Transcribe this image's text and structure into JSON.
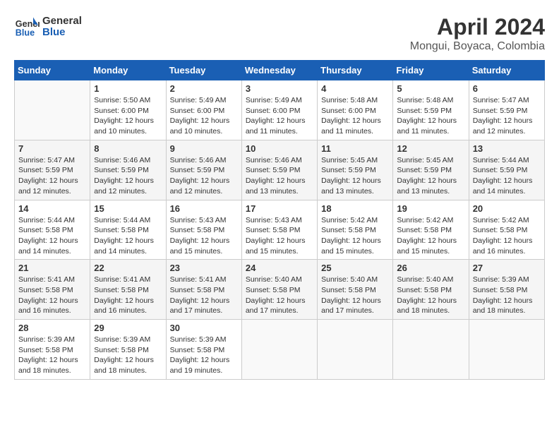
{
  "header": {
    "logo_line1": "General",
    "logo_line2": "Blue",
    "title": "April 2024",
    "subtitle": "Mongui, Boyaca, Colombia"
  },
  "calendar": {
    "days_of_week": [
      "Sunday",
      "Monday",
      "Tuesday",
      "Wednesday",
      "Thursday",
      "Friday",
      "Saturday"
    ],
    "weeks": [
      [
        {
          "day": "",
          "info": ""
        },
        {
          "day": "1",
          "info": "Sunrise: 5:50 AM\nSunset: 6:00 PM\nDaylight: 12 hours\nand 10 minutes."
        },
        {
          "day": "2",
          "info": "Sunrise: 5:49 AM\nSunset: 6:00 PM\nDaylight: 12 hours\nand 10 minutes."
        },
        {
          "day": "3",
          "info": "Sunrise: 5:49 AM\nSunset: 6:00 PM\nDaylight: 12 hours\nand 11 minutes."
        },
        {
          "day": "4",
          "info": "Sunrise: 5:48 AM\nSunset: 6:00 PM\nDaylight: 12 hours\nand 11 minutes."
        },
        {
          "day": "5",
          "info": "Sunrise: 5:48 AM\nSunset: 5:59 PM\nDaylight: 12 hours\nand 11 minutes."
        },
        {
          "day": "6",
          "info": "Sunrise: 5:47 AM\nSunset: 5:59 PM\nDaylight: 12 hours\nand 12 minutes."
        }
      ],
      [
        {
          "day": "7",
          "info": "Sunrise: 5:47 AM\nSunset: 5:59 PM\nDaylight: 12 hours\nand 12 minutes."
        },
        {
          "day": "8",
          "info": "Sunrise: 5:46 AM\nSunset: 5:59 PM\nDaylight: 12 hours\nand 12 minutes."
        },
        {
          "day": "9",
          "info": "Sunrise: 5:46 AM\nSunset: 5:59 PM\nDaylight: 12 hours\nand 12 minutes."
        },
        {
          "day": "10",
          "info": "Sunrise: 5:46 AM\nSunset: 5:59 PM\nDaylight: 12 hours\nand 13 minutes."
        },
        {
          "day": "11",
          "info": "Sunrise: 5:45 AM\nSunset: 5:59 PM\nDaylight: 12 hours\nand 13 minutes."
        },
        {
          "day": "12",
          "info": "Sunrise: 5:45 AM\nSunset: 5:59 PM\nDaylight: 12 hours\nand 13 minutes."
        },
        {
          "day": "13",
          "info": "Sunrise: 5:44 AM\nSunset: 5:59 PM\nDaylight: 12 hours\nand 14 minutes."
        }
      ],
      [
        {
          "day": "14",
          "info": "Sunrise: 5:44 AM\nSunset: 5:58 PM\nDaylight: 12 hours\nand 14 minutes."
        },
        {
          "day": "15",
          "info": "Sunrise: 5:44 AM\nSunset: 5:58 PM\nDaylight: 12 hours\nand 14 minutes."
        },
        {
          "day": "16",
          "info": "Sunrise: 5:43 AM\nSunset: 5:58 PM\nDaylight: 12 hours\nand 15 minutes."
        },
        {
          "day": "17",
          "info": "Sunrise: 5:43 AM\nSunset: 5:58 PM\nDaylight: 12 hours\nand 15 minutes."
        },
        {
          "day": "18",
          "info": "Sunrise: 5:42 AM\nSunset: 5:58 PM\nDaylight: 12 hours\nand 15 minutes."
        },
        {
          "day": "19",
          "info": "Sunrise: 5:42 AM\nSunset: 5:58 PM\nDaylight: 12 hours\nand 15 minutes."
        },
        {
          "day": "20",
          "info": "Sunrise: 5:42 AM\nSunset: 5:58 PM\nDaylight: 12 hours\nand 16 minutes."
        }
      ],
      [
        {
          "day": "21",
          "info": "Sunrise: 5:41 AM\nSunset: 5:58 PM\nDaylight: 12 hours\nand 16 minutes."
        },
        {
          "day": "22",
          "info": "Sunrise: 5:41 AM\nSunset: 5:58 PM\nDaylight: 12 hours\nand 16 minutes."
        },
        {
          "day": "23",
          "info": "Sunrise: 5:41 AM\nSunset: 5:58 PM\nDaylight: 12 hours\nand 17 minutes."
        },
        {
          "day": "24",
          "info": "Sunrise: 5:40 AM\nSunset: 5:58 PM\nDaylight: 12 hours\nand 17 minutes."
        },
        {
          "day": "25",
          "info": "Sunrise: 5:40 AM\nSunset: 5:58 PM\nDaylight: 12 hours\nand 17 minutes."
        },
        {
          "day": "26",
          "info": "Sunrise: 5:40 AM\nSunset: 5:58 PM\nDaylight: 12 hours\nand 18 minutes."
        },
        {
          "day": "27",
          "info": "Sunrise: 5:39 AM\nSunset: 5:58 PM\nDaylight: 12 hours\nand 18 minutes."
        }
      ],
      [
        {
          "day": "28",
          "info": "Sunrise: 5:39 AM\nSunset: 5:58 PM\nDaylight: 12 hours\nand 18 minutes."
        },
        {
          "day": "29",
          "info": "Sunrise: 5:39 AM\nSunset: 5:58 PM\nDaylight: 12 hours\nand 18 minutes."
        },
        {
          "day": "30",
          "info": "Sunrise: 5:39 AM\nSunset: 5:58 PM\nDaylight: 12 hours\nand 19 minutes."
        },
        {
          "day": "",
          "info": ""
        },
        {
          "day": "",
          "info": ""
        },
        {
          "day": "",
          "info": ""
        },
        {
          "day": "",
          "info": ""
        }
      ]
    ]
  }
}
